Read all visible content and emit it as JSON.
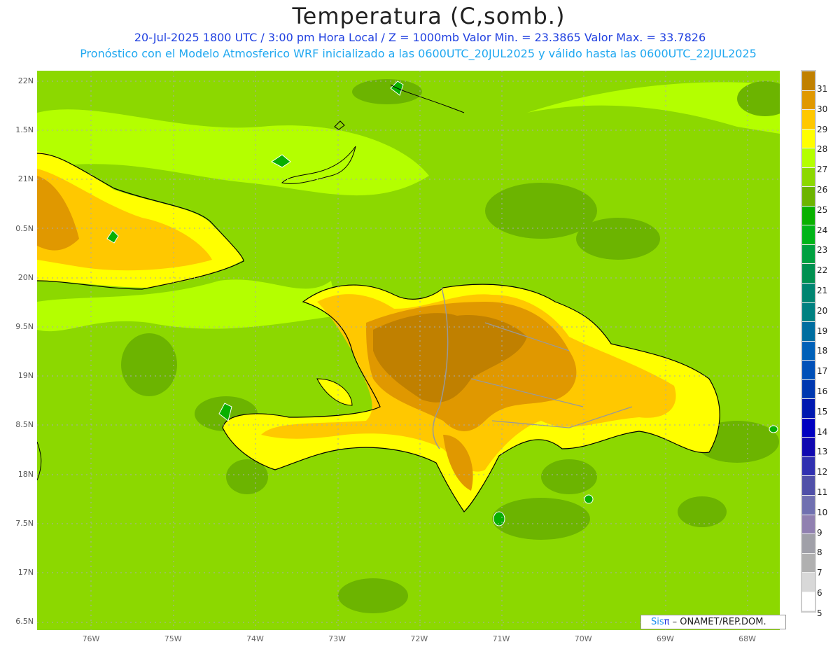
{
  "title": "Temperatura (C,somb.)",
  "subtitle1": "20-Jul-2025  1800 UTC / 3:00 pm Hora Local / Z = 1000mb   Valor Min. = 23.3865  Valor Max. = 33.7826",
  "subtitle2": "Pronóstico con el Modelo Atmosferico WRF inicializado a las 0600UTC_20JUL2025 y válido hasta las  0600UTC_22JUL2025",
  "lat_labels": [
    "22N",
    "1.5N",
    "21N",
    "0.5N",
    "20N",
    "9.5N",
    "19N",
    "8.5N",
    "18N",
    "7.5N",
    "17N",
    "6.5N"
  ],
  "lon_labels": [
    "76W",
    "75W",
    "74W",
    "73W",
    "72W",
    "71W",
    "70W",
    "69W",
    "68W"
  ],
  "colorbar": {
    "labels": [
      "31",
      "30",
      "29",
      "28",
      "27",
      "26",
      "25",
      "24",
      "23",
      "22",
      "21",
      "20",
      "19",
      "18",
      "17",
      "16",
      "15",
      "14",
      "13",
      "12",
      "11",
      "10",
      "9",
      "8",
      "7",
      "6",
      "5"
    ],
    "colors": [
      "#c08000",
      "#e09800",
      "#ffc800",
      "#ffff00",
      "#b4ff00",
      "#8cd800",
      "#6cb400",
      "#08b000",
      "#00b418",
      "#00a040",
      "#009050",
      "#008470",
      "#008080",
      "#006ea0",
      "#0060b8",
      "#0050b8",
      "#0038b0",
      "#0018b0",
      "#0000c0",
      "#1008b0",
      "#3030b0",
      "#5050a8",
      "#7070b0",
      "#9080b0",
      "#a0a0a8",
      "#b0b0b0",
      "#d8d8d8",
      "#ffffff"
    ]
  },
  "credit": {
    "brand": "Sis",
    "pi": "π",
    "text": " – ONAMET/REP.DOM."
  }
}
